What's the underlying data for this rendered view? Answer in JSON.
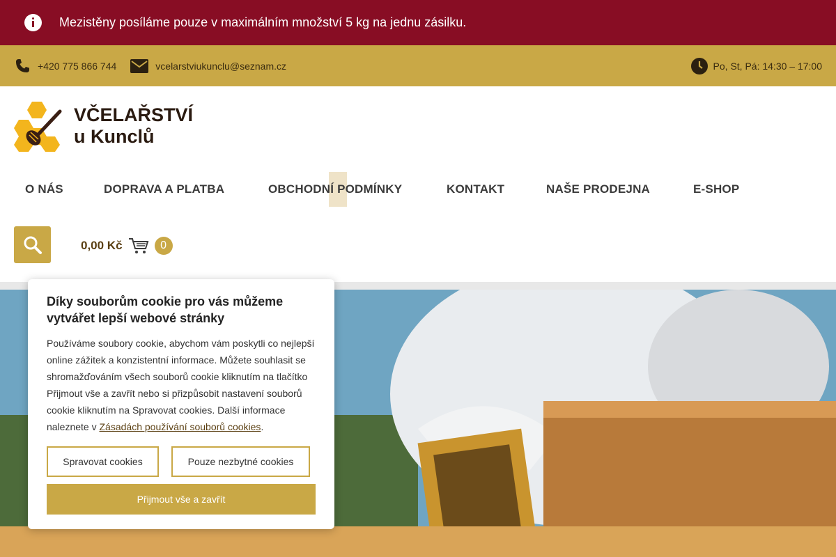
{
  "notice": {
    "text": "Mezistěny posíláme pouze v maximálním množství 5 kg na jednu zásilku.",
    "icon": "info-icon"
  },
  "contact": {
    "phone": "+420 775 866 744",
    "email": "vcelarstviukunclu@seznam.cz",
    "hours": "Po, St, Pá: 14:30 – 17:00"
  },
  "logo": {
    "line1": "VČELAŘSTVÍ",
    "line2": "u Kunclů"
  },
  "nav": [
    "O NÁS",
    "DOPRAVA A PLATBA",
    "OBCHODNÍ PODMÍNKY",
    "KONTAKT",
    "NAŠE PRODEJNA",
    "E-SHOP"
  ],
  "cart": {
    "price": "0,00 Kč",
    "count": "0"
  },
  "cookie": {
    "title": "Díky souborům cookie pro vás můžeme vytvářet lepší webové stránky",
    "text": "Používáme soubory cookie, abychom vám poskytli co nejlepší online zážitek a konzistentní informace. Můžete souhlasit se shromažďováním všech souborů cookie kliknutím na tlačítko Přijmout vše a zavřít nebo si přizpůsobit nastavení souborů cookie kliknutím na Spravovat cookies. Další informace naleznete v ",
    "link": "Zásadách používání souborů cookies",
    "text_end": ".",
    "btn_manage": "Spravovat cookies",
    "btn_necessary": "Pouze nezbytné cookies",
    "btn_accept": "Přijmout vše a zavřít"
  },
  "colors": {
    "notice": "#880d24",
    "accent": "#c9a846",
    "text_dark": "#3b3b3b"
  }
}
